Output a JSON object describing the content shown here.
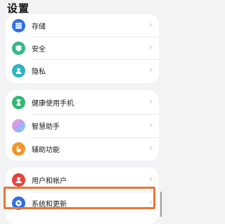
{
  "header": {
    "title": "设置"
  },
  "groups": [
    {
      "items": [
        {
          "label": "存储",
          "icon": "storage-icon",
          "color": "#2f6fe8"
        },
        {
          "label": "安全",
          "icon": "shield-icon",
          "color": "#35b987"
        },
        {
          "label": "隐私",
          "icon": "privacy-icon",
          "color": "#2fb3c1"
        }
      ]
    },
    {
      "items": [
        {
          "label": "健康使用手机",
          "icon": "hourglass-icon",
          "color": "#34b874"
        },
        {
          "label": "智慧助手",
          "icon": "assistant-icon",
          "color": "#e8a4d8"
        },
        {
          "label": "辅助功能",
          "icon": "hand-icon",
          "color": "#f0972a"
        }
      ]
    },
    {
      "items": [
        {
          "label": "用户和帐户",
          "icon": "user-icon",
          "color": "#e5433d"
        },
        {
          "label": "系统和更新",
          "icon": "system-gear-icon",
          "color": "#2f6fe8"
        }
      ]
    }
  ],
  "chevron": "›",
  "highlight_color": "#ea7637"
}
